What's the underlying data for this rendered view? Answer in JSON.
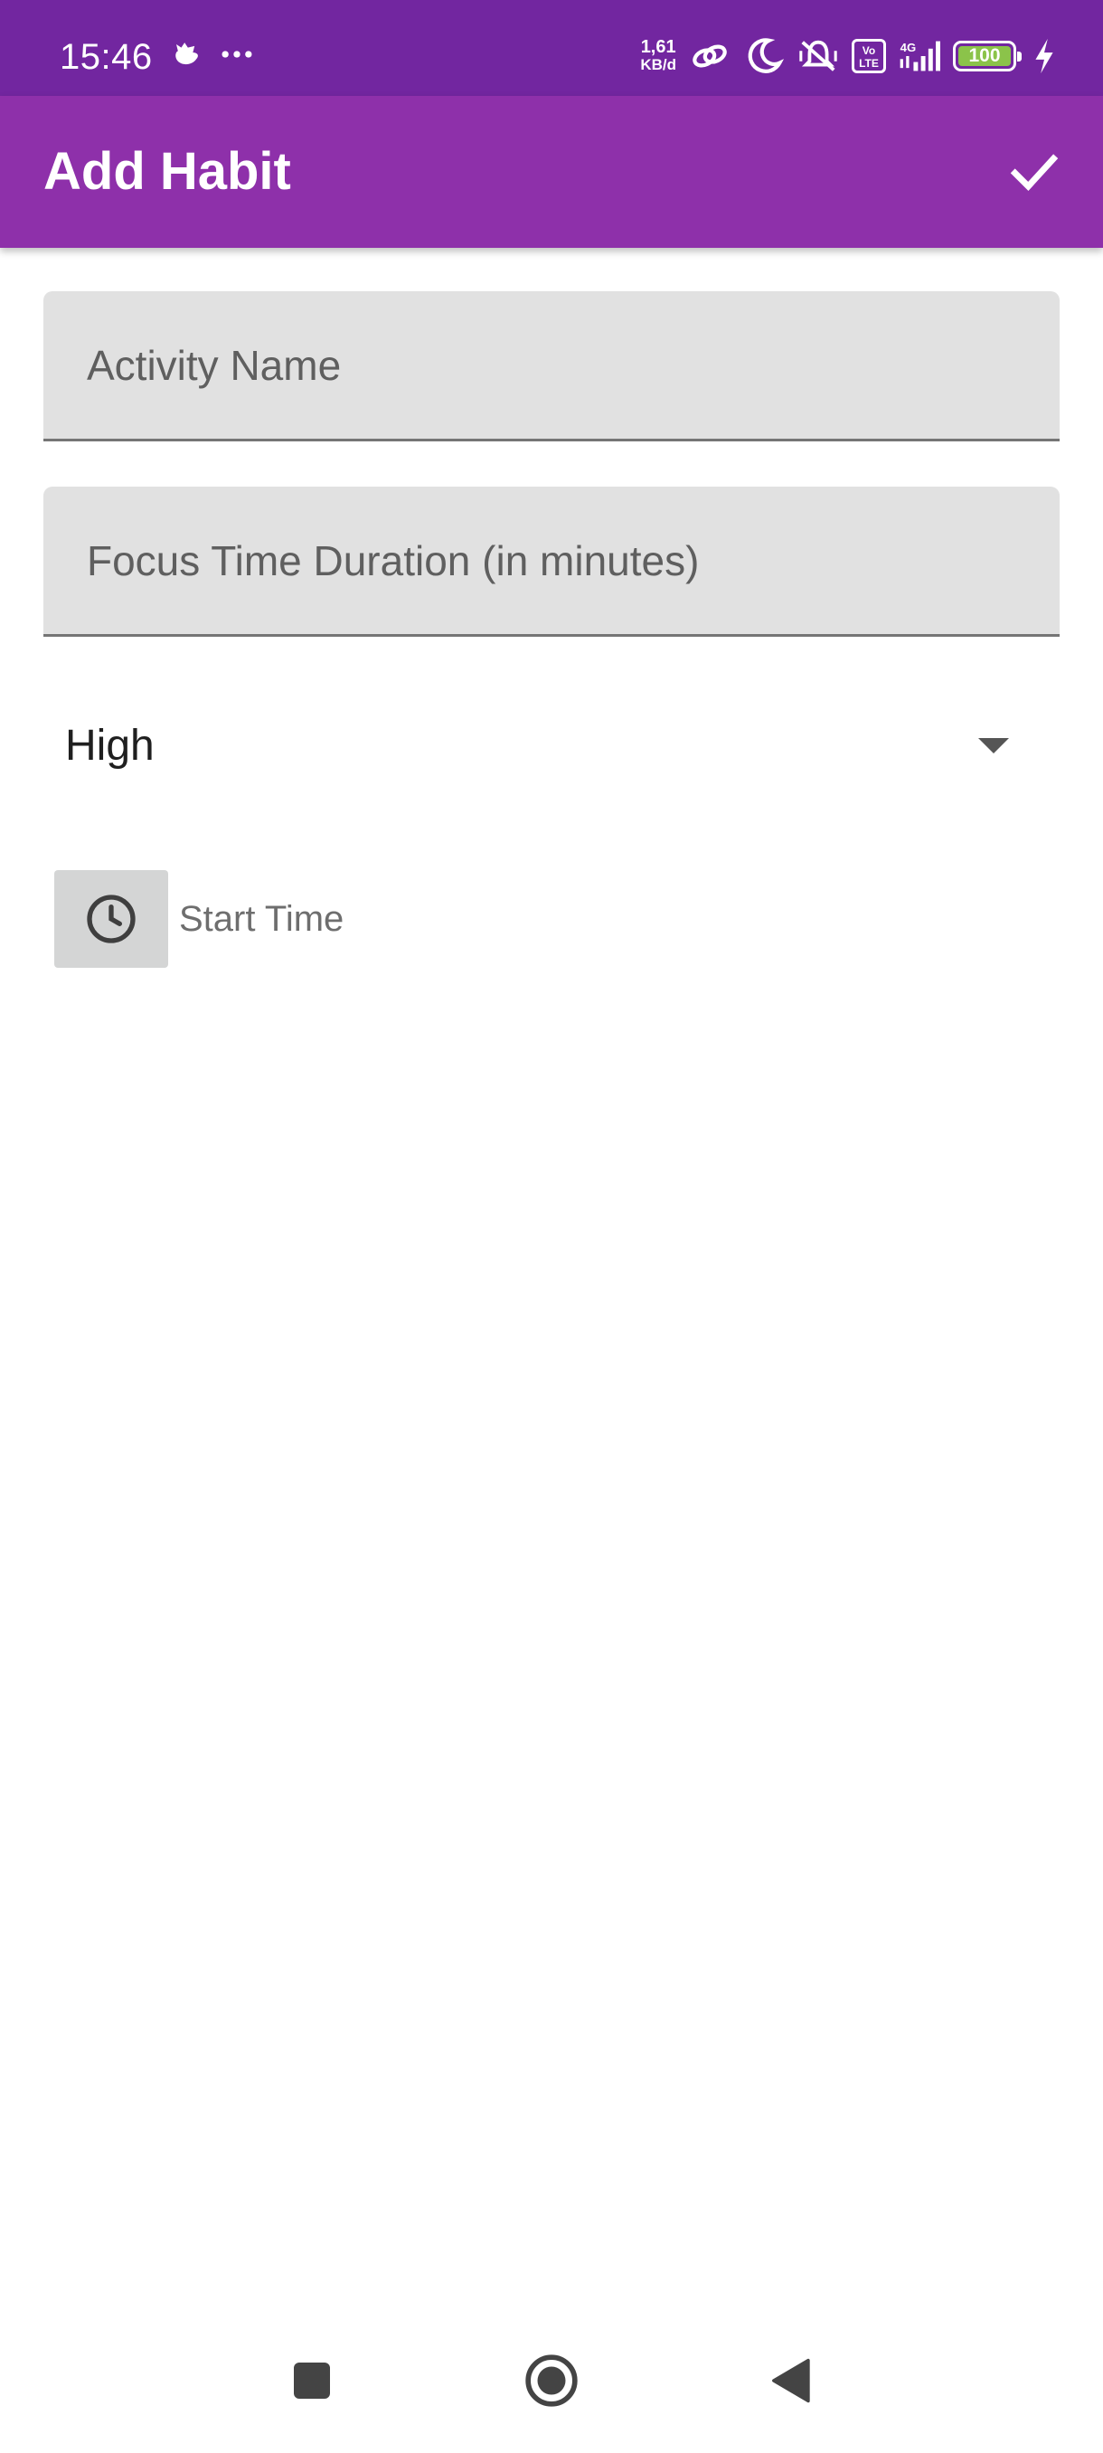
{
  "status_bar": {
    "time": "15:46",
    "net_speed_value": "1,61",
    "net_speed_unit": "KB/d",
    "volte_label": "Vo LTE",
    "network_type": "4G",
    "battery_level": "100",
    "battery_percent": 100,
    "icons": [
      "bird-icon",
      "more-dots-icon",
      "link-icon",
      "moon-icon",
      "mute-vibrate-icon",
      "volte-icon",
      "signal-icon",
      "battery-icon",
      "charging-bolt-icon"
    ]
  },
  "app_bar": {
    "title": "Add Habit",
    "save_icon": "check-icon"
  },
  "form": {
    "activity_name": {
      "placeholder": "Activity Name",
      "value": ""
    },
    "duration": {
      "placeholder": "Focus Time Duration (in minutes)",
      "value": ""
    },
    "priority": {
      "selected": "High",
      "icon": "dropdown-arrow-icon"
    },
    "start_time": {
      "label": "Start Time",
      "icon": "clock-icon"
    }
  },
  "nav_bar": {
    "icons": [
      "recents-square-icon",
      "home-circle-icon",
      "back-triangle-icon"
    ]
  },
  "colors": {
    "status_bar": "#7226a0",
    "app_bar": "#8e30aa",
    "field_background": "#e1e1e1",
    "battery_fill": "#8bc34a"
  }
}
